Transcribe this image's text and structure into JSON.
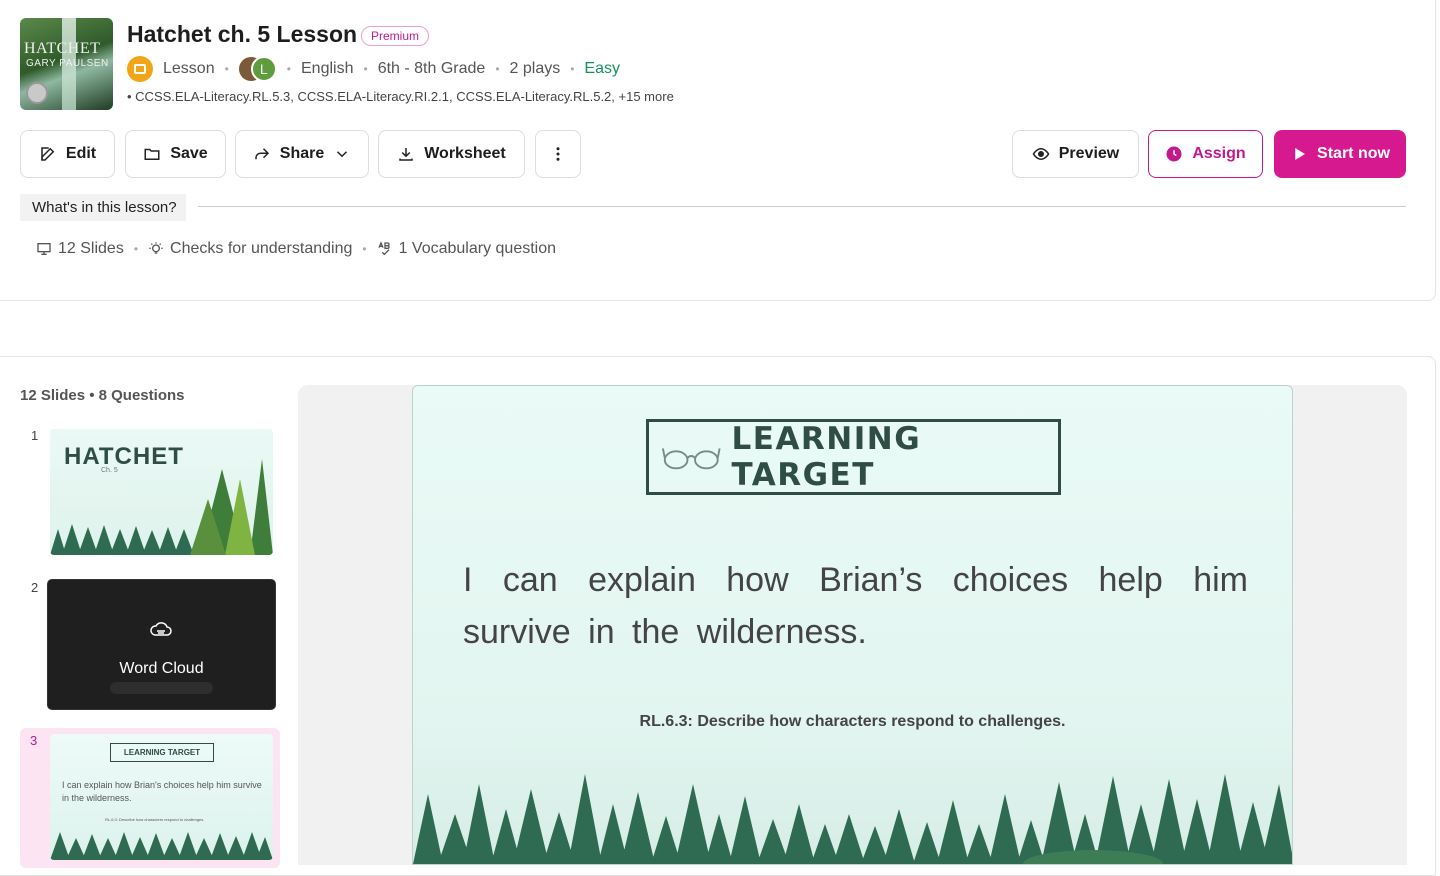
{
  "header": {
    "cover": {
      "title": "HATCHET",
      "author": "GARY PAULSEN"
    },
    "title": "Hatchet ch. 5 Lesson",
    "badge": "Premium",
    "meta": {
      "type": "Lesson",
      "author_initial": "L",
      "subject": "English",
      "grade": "6th - 8th Grade",
      "plays": "2 plays",
      "difficulty": "Easy"
    },
    "standards": "• CCSS.ELA-Literacy.RL.5.3, CCSS.ELA-Literacy.RI.2.1, CCSS.ELA-Literacy.RL.5.2, +15 more"
  },
  "toolbar": {
    "edit": "Edit",
    "save": "Save",
    "share": "Share",
    "worksheet": "Worksheet",
    "preview": "Preview",
    "assign": "Assign",
    "start": "Start now"
  },
  "lesson_info": {
    "heading": "What's in this lesson?",
    "slides": "12 Slides",
    "checks": "Checks for understanding",
    "vocab": "1 Vocabulary question"
  },
  "sidebar": {
    "heading": "12 Slides • 8 Questions",
    "thumbs": [
      {
        "num": "1",
        "title": "HATCHET",
        "subtitle": "Ch. 5"
      },
      {
        "num": "2",
        "title": "Word Cloud"
      },
      {
        "num": "3",
        "title": "LEARNING TARGET",
        "text": "I can explain how Brian's choices help him survive in the wilderness.",
        "standard": "RL.6.3: Describe how characters respond to challenges."
      }
    ]
  },
  "slide": {
    "heading": "LEARNING TARGET",
    "text": "I can explain how Brian’s choices help him survive in the wilderness.",
    "standard": "RL.6.3: Describe how characters respond to challenges."
  },
  "colors": {
    "brand_pink": "#d7198f",
    "easy_green": "#17915a",
    "slide_green": "#2f4d44",
    "forest_green": "#2e6b52"
  }
}
